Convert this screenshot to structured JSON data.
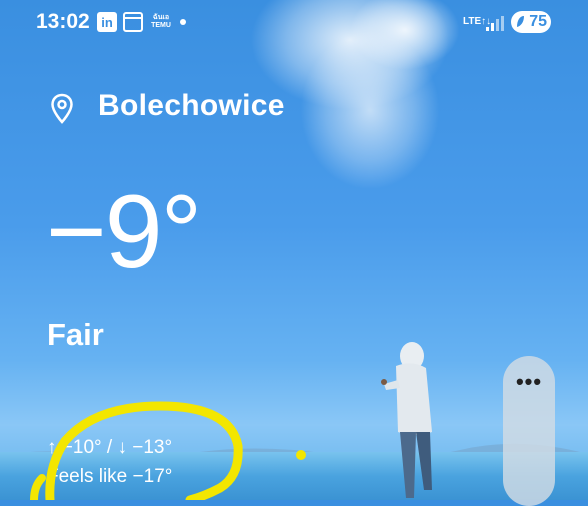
{
  "status_bar": {
    "time": "13:02",
    "linkedin_label": "in",
    "temu_label_top": "ฉันเอ",
    "temu_label_bottom": "TEMU",
    "network_label": "LTE",
    "network_arrows": "↑↓",
    "battery_level": "75"
  },
  "location": {
    "name": "Bolechowice"
  },
  "weather": {
    "temperature": "−9°",
    "condition": "Fair",
    "hi_lo": "↑ −10° / ↓ −13°",
    "feels_like": "Feels like −17°"
  },
  "side_panel": {
    "menu_label": "•••"
  },
  "colors": {
    "sky_top": "#3a8fe0",
    "sky_bottom": "#8ac7f6",
    "highlight_yellow": "#f3e600",
    "text": "#ffffff"
  }
}
